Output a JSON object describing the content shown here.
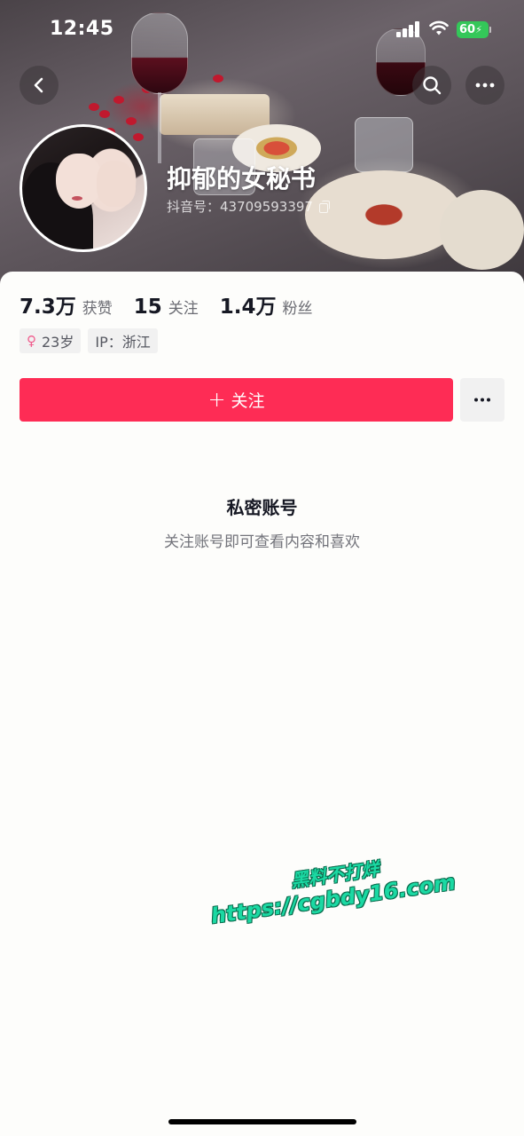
{
  "status_bar": {
    "time": "12:45",
    "battery": "60",
    "icons": [
      "signal-icon",
      "wifi-icon",
      "battery-icon"
    ]
  },
  "nav": {
    "icons": [
      "chevron-left-icon",
      "search-icon",
      "more-dots-icon"
    ]
  },
  "profile": {
    "nickname": "抑郁的女秘书",
    "douyin_id": "抖音号：43709593397"
  },
  "stats": [
    {
      "value": "7.3万",
      "label": "获赞"
    },
    {
      "value": "15",
      "label": "关注"
    },
    {
      "value": "1.4万",
      "label": "粉丝"
    }
  ],
  "tags": {
    "age": "23岁",
    "ip": "IP：浙江"
  },
  "actions": {
    "follow_label": "关注",
    "plus": "+"
  },
  "private_notice": {
    "title": "私密账号",
    "description": "关注账号即可查看内容和喜欢"
  },
  "watermark": {
    "line1": "黑料不打烊",
    "line2": "https://cgbdy16.com"
  },
  "colors": {
    "accent": "#fe2c55",
    "battery": "#34c759",
    "watermark": "#1bd9a3"
  }
}
